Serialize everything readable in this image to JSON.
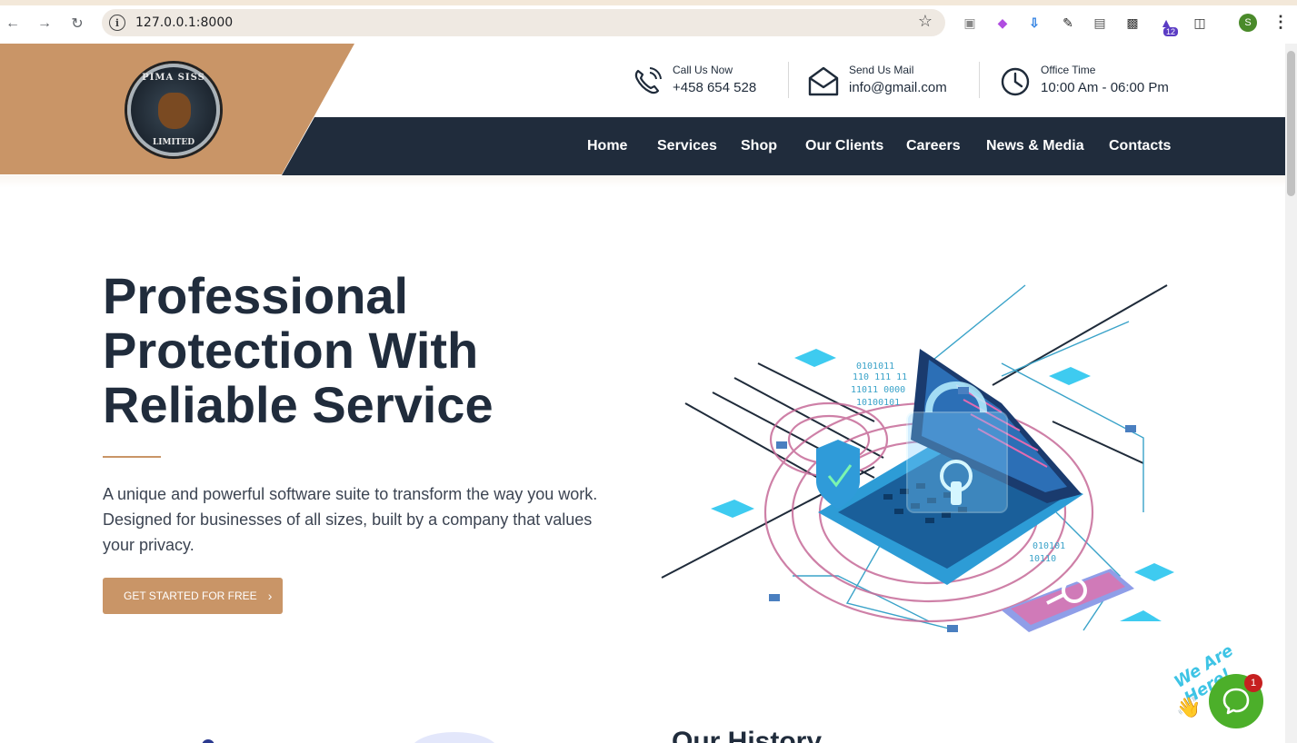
{
  "browser": {
    "url": "127.0.0.1:8000",
    "profile_initial": "S",
    "extension_badge": "12"
  },
  "logo": {
    "alt_text_top": "PIMA SISS",
    "alt_text_bottom": "LIMITED"
  },
  "contact": {
    "call": {
      "label": "Call Us Now",
      "value": "+458 654 528"
    },
    "mail": {
      "label": "Send Us Mail",
      "value": "info@gmail.com"
    },
    "time": {
      "label": "Office Time",
      "value": "10:00 Am - 06:00 Pm"
    }
  },
  "nav": {
    "items": [
      "Home",
      "Services",
      "Shop",
      "Our Clients",
      "Careers",
      "News & Media",
      "Contacts"
    ]
  },
  "hero": {
    "title_line1": "Professional",
    "title_line2": "Protection With",
    "title_line3": "Reliable Service",
    "description": "A unique and powerful software suite to transform the way you work. Designed for businesses of all sizes, built by a company that values your privacy.",
    "cta_label": "GET STARTED FOR FREE"
  },
  "section": {
    "history_title": "Our History"
  },
  "chat": {
    "tagline": "We Are Here!",
    "badge_count": "1"
  },
  "colors": {
    "accent": "#c99567",
    "navy": "#202c3c",
    "chat_green": "#4caf2a"
  }
}
